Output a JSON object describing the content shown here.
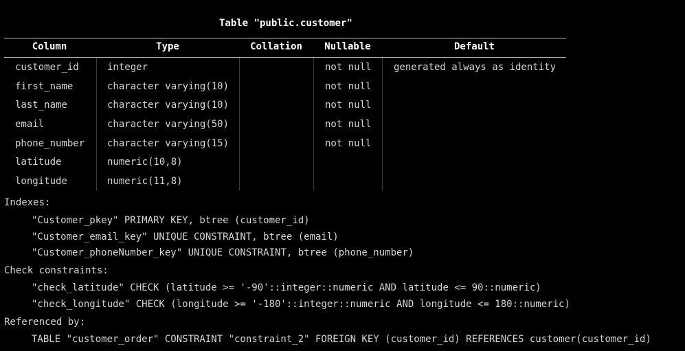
{
  "table_title": "Table \"public.customer\"",
  "headers": {
    "column": "Column",
    "type": "Type",
    "collation": "Collation",
    "nullable": "Nullable",
    "default": "Default"
  },
  "rows": [
    {
      "column": "customer_id",
      "type": "integer",
      "collation": "",
      "nullable": "not null",
      "default": "generated always as identity"
    },
    {
      "column": "first_name",
      "type": "character varying(10)",
      "collation": "",
      "nullable": "not null",
      "default": ""
    },
    {
      "column": "last_name",
      "type": "character varying(10)",
      "collation": "",
      "nullable": "not null",
      "default": ""
    },
    {
      "column": "email",
      "type": "character varying(50)",
      "collation": "",
      "nullable": "not null",
      "default": ""
    },
    {
      "column": "phone_number",
      "type": "character varying(15)",
      "collation": "",
      "nullable": "not null",
      "default": ""
    },
    {
      "column": "latitude",
      "type": "numeric(10,8)",
      "collation": "",
      "nullable": "",
      "default": ""
    },
    {
      "column": "longitude",
      "type": "numeric(11,8)",
      "collation": "",
      "nullable": "",
      "default": ""
    }
  ],
  "indexes": {
    "label": "Indexes:",
    "items": [
      "\"Customer_pkey\" PRIMARY KEY, btree (customer_id)",
      "\"Customer_email_key\" UNIQUE CONSTRAINT, btree (email)",
      "\"Customer_phoneNumber_key\" UNIQUE CONSTRAINT, btree (phone_number)"
    ]
  },
  "check_constraints": {
    "label": "Check constraints:",
    "items": [
      "\"check_latitude\" CHECK (latitude >= '-90'::integer::numeric AND latitude <= 90::numeric)",
      "\"check_longitude\" CHECK (longitude >= '-180'::integer::numeric AND longitude <= 180::numeric)"
    ]
  },
  "referenced_by": {
    "label": "Referenced by:",
    "items": [
      "TABLE \"customer_order\" CONSTRAINT \"constraint_2\" FOREIGN KEY (customer_id) REFERENCES customer(customer_id)"
    ]
  },
  "colors": {
    "background": "#000000",
    "text": "#d6d6d6",
    "header_text": "#ffffff"
  }
}
